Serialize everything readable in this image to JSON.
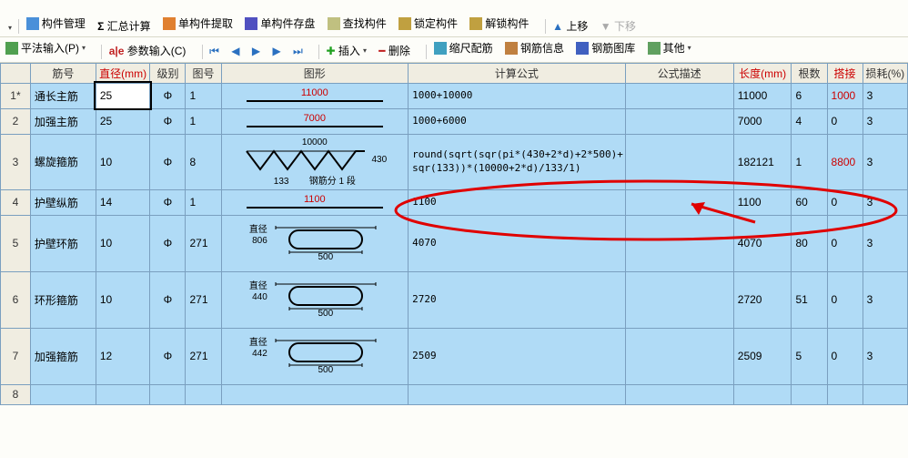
{
  "menubar": {
    "items": [
      "构件管理",
      "汇总计算",
      "单构件提取",
      "单构件存盘",
      "查找构件",
      "锁定构件",
      "解锁构件",
      "上移",
      "下移"
    ]
  },
  "toolbar2": {
    "pfInput": "平法输入(P)",
    "paramInput": "参数输入(C)",
    "nav": [
      "first",
      "prev",
      "play",
      "next",
      "last"
    ],
    "insert": "插入",
    "delete": "删除",
    "sfpj": "缩尺配筋",
    "gjxx": "钢筋信息",
    "gjtk": "钢筋图库",
    "other": "其他"
  },
  "headers": [
    "",
    "筋号",
    "直径(mm)",
    "级别",
    "图号",
    "图形",
    "计算公式",
    "公式描述",
    "长度(mm)",
    "根数",
    "搭接",
    "损耗(%)"
  ],
  "rows": [
    {
      "idx": "1*",
      "name": "通长主筋",
      "dia": "25",
      "grade": "Φ",
      "fig": "1",
      "formula": "1000+10000",
      "desc": "",
      "len": "11000",
      "qty": "6",
      "lap": "1000",
      "loss": "3",
      "shape": "line",
      "shapeText": "11000"
    },
    {
      "idx": "2",
      "name": "加强主筋",
      "dia": "25",
      "grade": "Φ",
      "fig": "1",
      "formula": "1000+6000",
      "desc": "",
      "len": "7000",
      "qty": "4",
      "lap": "0",
      "loss": "3",
      "shape": "line",
      "shapeText": "7000"
    },
    {
      "idx": "3",
      "name": "螺旋箍筋",
      "dia": "10",
      "grade": "Φ",
      "fig": "8",
      "formula": "round(sqrt(sqr(pi*(430+2*d)+2*500)+\nsqr(133))*(10000+2*d)/133/1)",
      "desc": "",
      "len": "182121",
      "qty": "1",
      "lap": "8800",
      "loss": "3",
      "shape": "spiral",
      "top": "10000",
      "right": "430",
      "below": "133",
      "extra": "钢筋分 1 段"
    },
    {
      "idx": "4",
      "name": "护壁纵筋",
      "dia": "14",
      "grade": "Φ",
      "fig": "1",
      "formula": "1100",
      "desc": "",
      "len": "1100",
      "qty": "60",
      "lap": "0",
      "loss": "3",
      "shape": "line",
      "shapeText": "1100"
    },
    {
      "idx": "5",
      "name": "护壁环筋",
      "dia": "10",
      "grade": "Φ",
      "fig": "271",
      "formula": "4070",
      "desc": "",
      "len": "4070",
      "qty": "80",
      "lap": "0",
      "loss": "3",
      "shape": "stadium",
      "left": "806",
      "bottom": "500",
      "legend": "直径"
    },
    {
      "idx": "6",
      "name": "环形箍筋",
      "dia": "10",
      "grade": "Φ",
      "fig": "271",
      "formula": "2720",
      "desc": "",
      "len": "2720",
      "qty": "51",
      "lap": "0",
      "loss": "3",
      "shape": "stadium",
      "left": "440",
      "bottom": "500",
      "legend": "直径"
    },
    {
      "idx": "7",
      "name": "加强箍筋",
      "dia": "12",
      "grade": "Φ",
      "fig": "271",
      "formula": "2509",
      "desc": "",
      "len": "2509",
      "qty": "5",
      "lap": "0",
      "loss": "3",
      "shape": "stadium",
      "left": "442",
      "bottom": "500",
      "legend": "直径"
    },
    {
      "idx": "8",
      "name": "",
      "dia": "",
      "grade": "",
      "fig": "",
      "formula": "",
      "desc": "",
      "len": "",
      "qty": "",
      "lap": "",
      "loss": "",
      "shape": "none"
    }
  ],
  "annot": {
    "highlightRow": 3
  }
}
